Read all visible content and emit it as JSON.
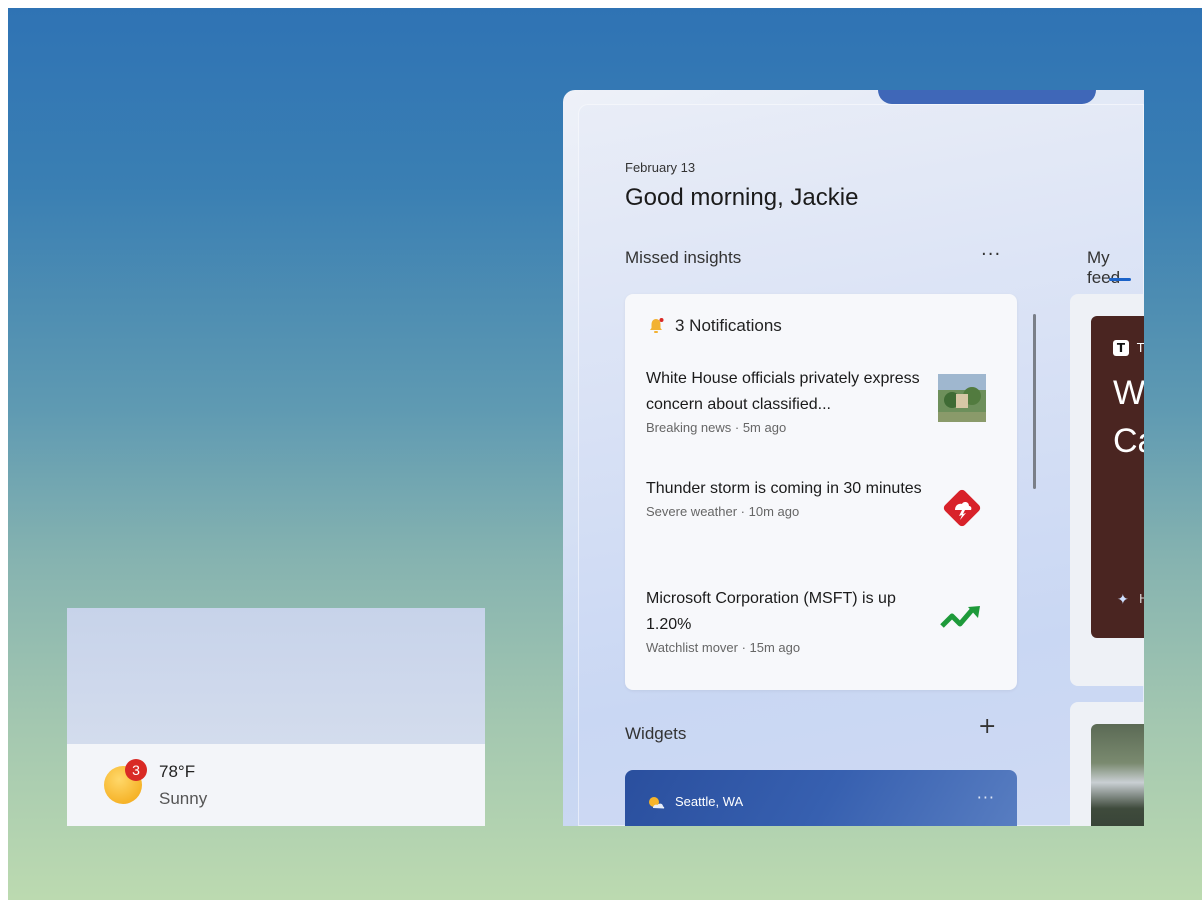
{
  "taskbar_weather": {
    "badge_count": "3",
    "temperature": "78°F",
    "condition": "Sunny"
  },
  "panel": {
    "date": "February 13",
    "greeting": "Good morning, Jackie",
    "missed_insights": {
      "title": "Missed insights",
      "more": "···",
      "notifications_header": "3 Notifications",
      "items": [
        {
          "title": "White House officials privately express concern about classified...",
          "meta": "Breaking news · 5m ago",
          "icon": "news-thumbnail-icon"
        },
        {
          "title": "Thunder storm is coming in 30 minutes",
          "meta": "Severe weather · 10m ago",
          "icon": "storm-warning-icon"
        },
        {
          "title": "Microsoft Corporation (MSFT) is up 1.20%",
          "meta": "Watchlist mover · 15m ago",
          "icon": "stock-up-icon"
        }
      ]
    },
    "feed": {
      "tab_label": "My feed",
      "source_initial": "T",
      "headline_line1": "Wh",
      "headline_line2": "Ca",
      "footer": "Hi"
    },
    "widgets": {
      "title": "Widgets",
      "add": "+",
      "weather_location": "Seattle, WA",
      "more": "···"
    }
  },
  "colors": {
    "accent": "#1a62c8",
    "badge": "#d92a25",
    "storm": "#d8222a",
    "stock": "#1e9a3a"
  }
}
